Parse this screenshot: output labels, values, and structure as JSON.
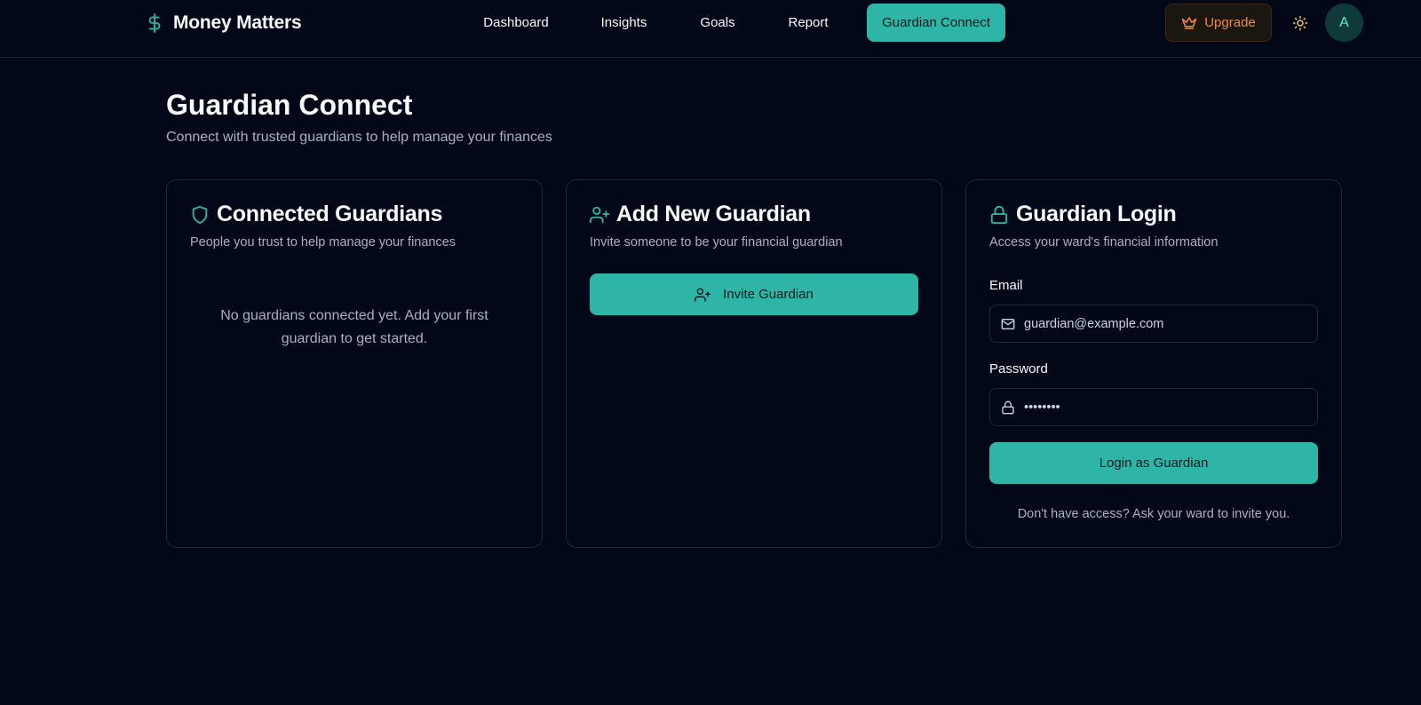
{
  "app": {
    "name": "Money Matters",
    "brand_icon": "dollar-sign-icon",
    "accent_color": "#2fb5a7"
  },
  "nav": {
    "items": [
      {
        "label": "Dashboard",
        "active": false
      },
      {
        "label": "Insights",
        "active": false
      },
      {
        "label": "Goals",
        "active": false
      },
      {
        "label": "Report",
        "active": false
      },
      {
        "label": "Guardian Connect",
        "active": true
      }
    ],
    "upgrade_label": "Upgrade",
    "upgrade_icon": "crown-icon",
    "theme_icon": "sun-icon",
    "avatar_initial": "A"
  },
  "page": {
    "title": "Guardian Connect",
    "subtitle": "Connect with trusted guardians to help manage your finances"
  },
  "connected": {
    "icon": "shield-icon",
    "title": "Connected Guardians",
    "description": "People you trust to help manage your finances",
    "empty_message": "No guardians connected yet. Add your first guardian to get started."
  },
  "add_new": {
    "icon": "user-plus-icon",
    "title": "Add New Guardian",
    "description": "Invite someone to be your financial guardian",
    "invite_label": "Invite Guardian"
  },
  "login": {
    "icon": "lock-icon",
    "title": "Guardian Login",
    "description": "Access your ward's financial information",
    "email_label": "Email",
    "email_placeholder": "guardian@example.com",
    "password_label": "Password",
    "password_placeholder": "••••••••",
    "submit_label": "Login as Guardian",
    "footnote": "Don't have access? Ask your ward to invite you."
  }
}
